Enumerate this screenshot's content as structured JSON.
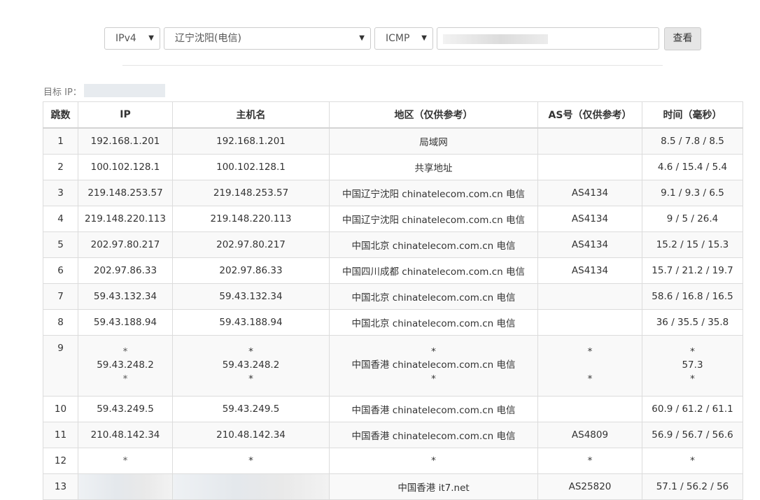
{
  "toolbar": {
    "ip_version": "IPv4",
    "location": "辽宁沈阳(电信)",
    "protocol": "ICMP",
    "query_label": "查看"
  },
  "target_label": "目标 IP：",
  "table": {
    "headers": [
      "跳数",
      "IP",
      "主机名",
      "地区（仅供参考）",
      "AS号（仅供参考）",
      "时间（毫秒）"
    ],
    "rows": [
      {
        "hop": "1",
        "ip": "192.168.1.201",
        "host": "192.168.1.201",
        "region": "局域网",
        "asn": "",
        "time": "8.5 / 7.8 / 8.5"
      },
      {
        "hop": "2",
        "ip": "100.102.128.1",
        "host": "100.102.128.1",
        "region": "共享地址",
        "asn": "",
        "time": "4.6 / 15.4 / 5.4"
      },
      {
        "hop": "3",
        "ip": "219.148.253.57",
        "host": "219.148.253.57",
        "region": "中国辽宁沈阳 chinatelecom.com.cn 电信",
        "asn": "AS4134",
        "time": "9.1 / 9.3 / 6.5"
      },
      {
        "hop": "4",
        "ip": "219.148.220.113",
        "host": "219.148.220.113",
        "region": "中国辽宁沈阳 chinatelecom.com.cn 电信",
        "asn": "AS4134",
        "time": "9 / 5 / 26.4"
      },
      {
        "hop": "5",
        "ip": "202.97.80.217",
        "host": "202.97.80.217",
        "region": "中国北京 chinatelecom.com.cn 电信",
        "asn": "AS4134",
        "time": "15.2 / 15 / 15.3"
      },
      {
        "hop": "6",
        "ip": "202.97.86.33",
        "host": "202.97.86.33",
        "region": "中国四川成都 chinatelecom.com.cn 电信",
        "asn": "AS4134",
        "time": "15.7 / 21.2 / 19.7"
      },
      {
        "hop": "7",
        "ip": "59.43.132.34",
        "host": "59.43.132.34",
        "region": "中国北京 chinatelecom.com.cn 电信",
        "asn": "",
        "time": "58.6 / 16.8 / 16.5"
      },
      {
        "hop": "8",
        "ip": "59.43.188.94",
        "host": "59.43.188.94",
        "region": "中国北京 chinatelecom.com.cn 电信",
        "asn": "",
        "time": "36 / 35.5 / 35.8"
      },
      {
        "hop": "9",
        "ip": [
          "*",
          "59.43.248.2",
          "*"
        ],
        "host": [
          "*",
          "59.43.248.2",
          "*"
        ],
        "region": [
          "*",
          "中国香港 chinatelecom.com.cn 电信",
          "*"
        ],
        "asn": [
          "*",
          "",
          "*"
        ],
        "time": [
          "*",
          "57.3",
          "*"
        ]
      },
      {
        "hop": "10",
        "ip": "59.43.249.5",
        "host": "59.43.249.5",
        "region": "中国香港 chinatelecom.com.cn 电信",
        "asn": "",
        "time": "60.9 / 61.2 / 61.1"
      },
      {
        "hop": "11",
        "ip": "210.48.142.34",
        "host": "210.48.142.34",
        "region": "中国香港 chinatelecom.com.cn 电信",
        "asn": "AS4809",
        "time": "56.9 / 56.7 / 56.6"
      },
      {
        "hop": "12",
        "ip": "*",
        "host": "*",
        "region": "*",
        "asn": "*",
        "time": "*"
      },
      {
        "hop": "13",
        "ip": "",
        "host": "",
        "region": "中国香港 it7.net",
        "asn": "AS25820",
        "time": "57.1 / 56.2 / 56"
      }
    ]
  }
}
